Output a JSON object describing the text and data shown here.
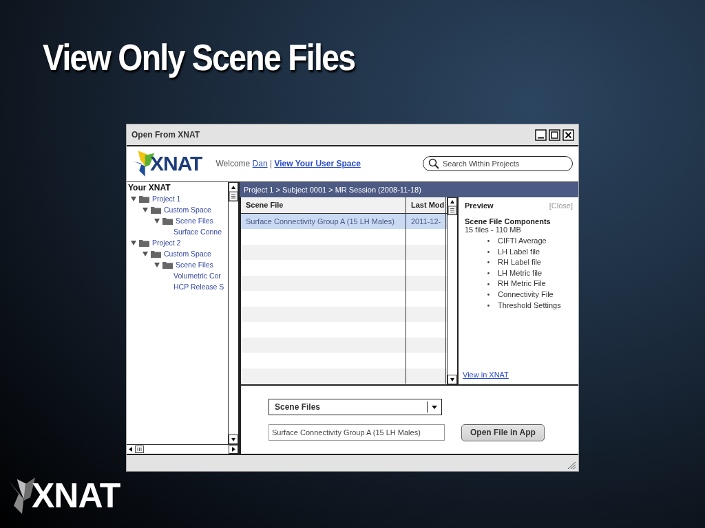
{
  "slide": {
    "title": "View Only Scene Files",
    "footer_logo": "XNAT"
  },
  "window": {
    "title": "Open From XNAT"
  },
  "header": {
    "logo": "XNAT",
    "welcome": "Welcome",
    "user": "Dan",
    "separator": "|",
    "user_space_link": "View Your User Space",
    "search": {
      "placeholder": "Search Within Projects"
    }
  },
  "tree": {
    "title": "Your XNAT",
    "items": [
      {
        "label": "Project 1",
        "expanded": true,
        "children": [
          {
            "label": "Custom Space",
            "expanded": true,
            "children": [
              {
                "label": "Scene Files",
                "expanded": true,
                "children": [
                  {
                    "label": "Surface Conne"
                  }
                ]
              }
            ]
          }
        ]
      },
      {
        "label": "Project 2",
        "expanded": true,
        "children": [
          {
            "label": "Custom Space",
            "expanded": true,
            "children": [
              {
                "label": "Scene Files",
                "expanded": true,
                "children": [
                  {
                    "label": "Volumetric Cor"
                  },
                  {
                    "label": "HCP Release S"
                  }
                ]
              }
            ]
          }
        ]
      }
    ]
  },
  "breadcrumb": "Project 1 > Subject 0001 > MR Session (2008-11-18)",
  "table": {
    "columns": [
      "Scene File",
      "Last Mod"
    ],
    "rows": [
      {
        "cells": [
          "Surface Connectivity Group A (15 LH Males)",
          "2011-12-"
        ],
        "selected": true
      }
    ]
  },
  "preview": {
    "title": "Preview",
    "close": "[Close]",
    "heading": "Scene File Components",
    "summary": "15 files - 110 MB",
    "items": [
      "CIFTI Average",
      "LH Label file",
      "RH Label file",
      "LH Metric file",
      "RH Metric File",
      "Connectivity File",
      "Threshold Settings"
    ],
    "link": "View in XNAT"
  },
  "bottom": {
    "dropdown": {
      "value": "Scene Files"
    },
    "file_field": {
      "value": "Surface Connectivity Group A (15 LH Males)"
    },
    "button": "Open File in App"
  }
}
